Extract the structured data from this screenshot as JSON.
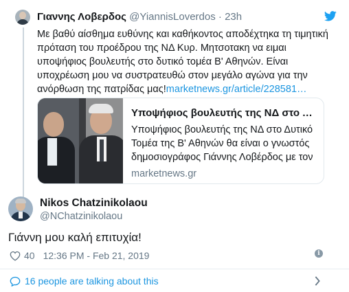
{
  "parent_tweet": {
    "author_name": "Γιαννης Λοβερδος",
    "handle": "@YiannisLoverdos",
    "dot": "·",
    "time": "23h",
    "text": "Με βαθύ αίσθημα ευθύνης και καθήκοντος αποδέχτηκα τη τιμητική πρόταση του προέδρου της ΝΔ Κυρ. Μητσοτακη να ειμαι υποψήφιος βουλευτής στο δυτικό τομέα Β' Αθηνών. Είναι υποχρέωση μου να συστρατευθώ στον μεγάλο αγώνα για την ανόρθωση της πατρίδας μας!",
    "link": "marketnews.gr/article/228581…",
    "card": {
      "title": "Υποψήφιος βουλευτής της ΝΔ στο Δυ…",
      "description": "Υποψήφιος βουλευτής της ΝΔ στο Δυτικό Τομέα της Β' Αθηνών θα είναι ο γνωστός δημοσιογράφος Γιάννης Λοβέρδος με τον",
      "domain": "marketnews.gr"
    }
  },
  "main_tweet": {
    "author_name": "Nikos Chatzinikolaou",
    "handle": "@NChatzinikolaou",
    "text": "Γιάννη μου καλή επιτυχία!",
    "likes": "40",
    "timestamp": "12:36 PM - Feb 21, 2019",
    "info_icon": "i"
  },
  "footer": {
    "talking": "16 people are talking about this"
  },
  "icons": {
    "bird": "twitter-bird-icon",
    "heart": "heart-icon",
    "info": "info-icon",
    "bubble": "speech-bubble-icon",
    "chevron": "chevron-right-icon"
  },
  "colors": {
    "link": "#1b95e0",
    "secondary_text": "#657786",
    "brand": "#1da1f2"
  }
}
